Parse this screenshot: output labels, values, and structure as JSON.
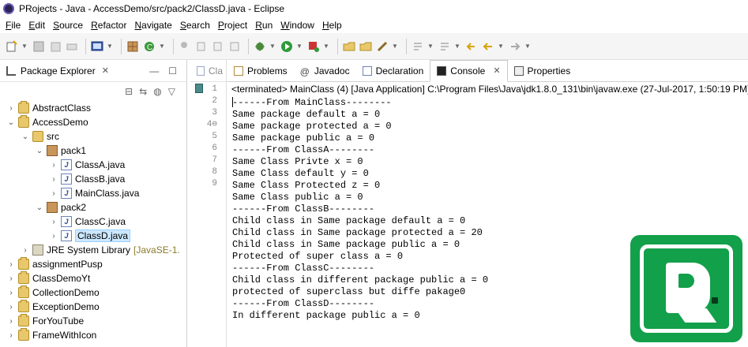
{
  "window": {
    "title": "PRojects - Java - AccessDemo/src/pack2/ClassD.java - Eclipse"
  },
  "menu": [
    "File",
    "Edit",
    "Source",
    "Refactor",
    "Navigate",
    "Search",
    "Project",
    "Run",
    "Window",
    "Help"
  ],
  "package_explorer": {
    "title": "Package Explorer",
    "tree": [
      {
        "label": "AbstractClass",
        "icon": "project-folder-icon",
        "level": 0,
        "expanded": false
      },
      {
        "label": "AccessDemo",
        "icon": "project-folder-icon",
        "level": 0,
        "expanded": true
      },
      {
        "label": "src",
        "icon": "source-folder-icon",
        "level": 1,
        "expanded": true
      },
      {
        "label": "pack1",
        "icon": "package-icon",
        "level": 2,
        "expanded": true
      },
      {
        "label": "ClassA.java",
        "icon": "java-file-icon",
        "level": 3,
        "expanded": false
      },
      {
        "label": "ClassB.java",
        "icon": "java-file-icon",
        "level": 3,
        "expanded": false
      },
      {
        "label": "MainClass.java",
        "icon": "java-file-icon",
        "level": 3,
        "expanded": false
      },
      {
        "label": "pack2",
        "icon": "package-icon",
        "level": 2,
        "expanded": true
      },
      {
        "label": "ClassC.java",
        "icon": "java-file-icon",
        "level": 3,
        "expanded": false
      },
      {
        "label": "ClassD.java",
        "icon": "java-file-icon",
        "level": 3,
        "expanded": false,
        "selected": true
      },
      {
        "label": "JRE System Library",
        "suffix": "[JavaSE-1.",
        "icon": "library-icon",
        "level": 1,
        "expanded": false
      },
      {
        "label": "assignmentPusp",
        "icon": "project-folder-icon",
        "level": 0,
        "expanded": false
      },
      {
        "label": "ClassDemoYt",
        "icon": "project-folder-icon",
        "level": 0,
        "expanded": false
      },
      {
        "label": "CollectionDemo",
        "icon": "project-folder-icon",
        "level": 0,
        "expanded": false
      },
      {
        "label": "ExceptionDemo",
        "icon": "project-folder-icon",
        "level": 0,
        "expanded": false
      },
      {
        "label": "ForYouTube",
        "icon": "project-folder-icon",
        "level": 0,
        "expanded": false
      },
      {
        "label": "FrameWithIcon",
        "icon": "project-folder-icon",
        "level": 0,
        "expanded": false
      }
    ]
  },
  "editor": {
    "tab_label": "Cla",
    "line_numbers": [
      "1",
      "2",
      "3",
      "4⊖",
      "5",
      "6",
      "7",
      "8",
      "9"
    ]
  },
  "console_view": {
    "tabs": [
      {
        "label": "Problems",
        "icon": "problems-icon",
        "active": false
      },
      {
        "label": "Javadoc",
        "icon": "javadoc-icon",
        "active": false
      },
      {
        "label": "Declaration",
        "icon": "declaration-icon",
        "active": false
      },
      {
        "label": "Console",
        "icon": "console-icon",
        "active": true
      },
      {
        "label": "Properties",
        "icon": "properties-icon",
        "active": false
      }
    ],
    "terminated_label": "<terminated> MainClass (4) [Java Application] C:\\Program Files\\Java\\jdk1.8.0_131\\bin\\javaw.exe (27-Jul-2017, 1:50:19 PM)",
    "output": [
      "------From MainClass--------",
      "Same package default a = 0",
      "Same package protected a = 0",
      "Same package public a = 0",
      "------From ClassA--------",
      "Same Class Privte x = 0",
      "Same Class default y = 0",
      "Same Class Protected z = 0",
      "Same Class public a = 0",
      "------From ClassB--------",
      "Child class in Same package default a = 0",
      "Child class in Same package protected a = 20",
      "Child class in Same package public a = 0",
      "Protected of super class a = 0",
      "------From ClassC--------",
      "Child class in different package public a = 0",
      "protected of superclass but diffe pakage0",
      "------From ClassD--------",
      "In different package public a = 0"
    ]
  },
  "colors": {
    "selection": "#cce8ff",
    "logo_green": "#12a04a"
  }
}
